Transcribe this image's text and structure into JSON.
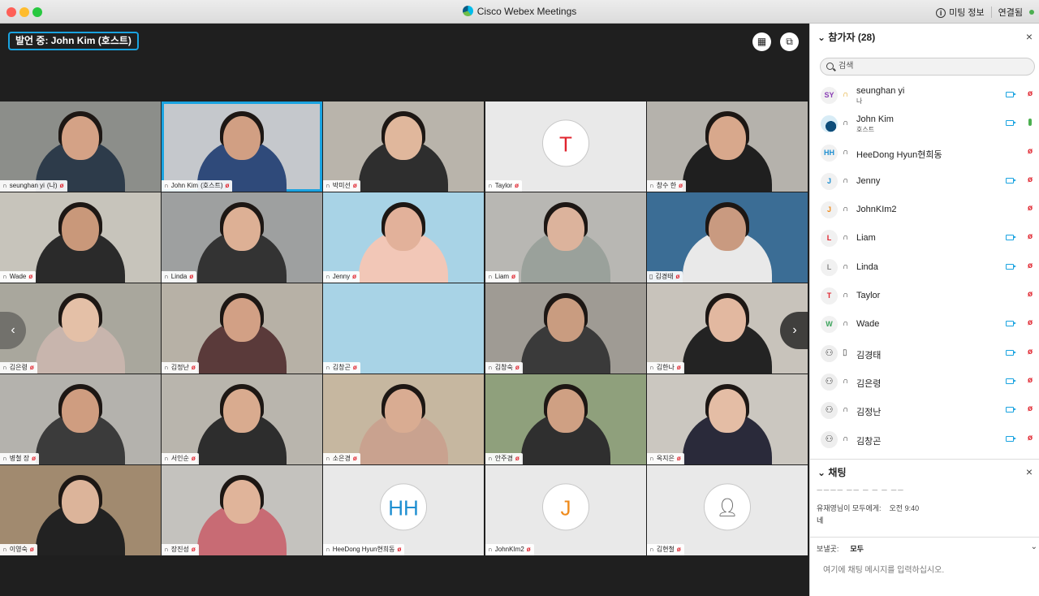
{
  "titlebar": {
    "title": "Cisco Webex Meetings",
    "meeting_info": "미팅 정보",
    "connection": "연결됨"
  },
  "stage": {
    "speaker": "발언 중:  John Kim (호스트)",
    "layout_icon": "grid-icon",
    "popout_icon": "popout-icon",
    "prev_arrow": "‹",
    "next_arrow": "›"
  },
  "tiles": [
    {
      "name": "seunghan yi",
      "suffix": "(나)",
      "bg": "#8c8e8a",
      "skin": "#d4a286",
      "shirt": "#2d3b4a",
      "icon": "headset"
    },
    {
      "name": "John Kim",
      "suffix": "(호스트)",
      "bg": "#c5c8cc",
      "skin": "#d19f83",
      "shirt": "#2f4a7a",
      "icon": "headset",
      "active": true
    },
    {
      "name": "박미선",
      "bg": "#b9b4ab",
      "skin": "#e0b79c",
      "shirt": "#2e2e2e",
      "icon": "headset"
    },
    {
      "name": "Taylor",
      "avatar": "T",
      "avatar_color": "#e0242e",
      "icon": "headset"
    },
    {
      "name": "창수 한",
      "bg": "#b5b2ac",
      "skin": "#d8a88c",
      "shirt": "#1f1f1f",
      "icon": "headset"
    },
    {
      "name": "Wade",
      "bg": "#c7c4bb",
      "skin": "#c9987a",
      "shirt": "#2a2a2a",
      "icon": "headset"
    },
    {
      "name": "Linda",
      "bg": "#9ea0a0",
      "skin": "#ddb095",
      "shirt": "#333333",
      "icon": "headset"
    },
    {
      "name": "Jenny",
      "bg": "#a8d3e6",
      "skin": "#e2b19a",
      "shirt": "#f2c7b7",
      "icon": "headset"
    },
    {
      "name": "Liam",
      "bg": "#b8b7b3",
      "skin": "#dcb39c",
      "shirt": "#9aa19b",
      "icon": "headset"
    },
    {
      "name": "김경태",
      "bg": "#3b6d95",
      "skin": "#c99a80",
      "shirt": "#e9e9e9",
      "icon": "phone"
    },
    {
      "name": "김은령",
      "bg": "#a9a79d",
      "skin": "#e4c0a7",
      "shirt": "#c8b5ad",
      "icon": "headset"
    },
    {
      "name": "김정난",
      "bg": "#b7b1a6",
      "skin": "#d2a085",
      "shirt": "#5a3a3a",
      "icon": "headset"
    },
    {
      "name": "김창곤",
      "bg": "#a8d3e6",
      "skin": "#a8d3e6",
      "shirt": "#a8d3e6",
      "icon": "headset"
    },
    {
      "name": "김창숙",
      "bg": "#9f9b94",
      "skin": "#c99c80",
      "shirt": "#3a3a3a",
      "icon": "headset"
    },
    {
      "name": "김한나",
      "bg": "#c8c3bb",
      "skin": "#e2b8a0",
      "shirt": "#232323",
      "icon": "headset"
    },
    {
      "name": "병철 장",
      "bg": "#b4b2ad",
      "skin": "#cf9d80",
      "shirt": "#3b3b3b",
      "icon": "headset"
    },
    {
      "name": "서인순",
      "bg": "#b9b5ad",
      "skin": "#d9ab8f",
      "shirt": "#2d2d2d",
      "icon": "headset"
    },
    {
      "name": "소은경",
      "bg": "#c6b7a0",
      "skin": "#d9ac92",
      "shirt": "#c9a28f",
      "icon": "headset"
    },
    {
      "name": "안주경",
      "bg": "#8fa07c",
      "skin": "#cfa083",
      "shirt": "#2f2f2f",
      "icon": "headset"
    },
    {
      "name": "옥지은",
      "bg": "#cbc7c0",
      "skin": "#e4bda5",
      "shirt": "#2a2a3a",
      "icon": "headset"
    },
    {
      "name": "이영숙",
      "bg": "#a18a6f",
      "skin": "#dcb49a",
      "shirt": "#222222",
      "icon": "headset"
    },
    {
      "name": "장진성",
      "bg": "#c4c2be",
      "skin": "#e0b49a",
      "shirt": "#c86b74",
      "icon": "headset"
    },
    {
      "name": "HeeDong Hyun현희동",
      "avatar": "HH",
      "avatar_color": "#1f8fd1",
      "icon": "headset"
    },
    {
      "name": "JohnKIm2",
      "avatar": "J",
      "avatar_color": "#ef8b1c",
      "icon": "headset"
    },
    {
      "name": "김현철",
      "avatar": "user",
      "avatar_color": "#444444",
      "icon": "headset"
    }
  ],
  "participants": {
    "title": "참가자 (28)",
    "search_placeholder": "검색",
    "list": [
      {
        "initials": "SY",
        "color": "#8a3fb5",
        "name": "seunghan yi",
        "sub": "나",
        "icon": "headset-warn",
        "cam": true,
        "muted": true
      },
      {
        "initials": "",
        "color": "#1aa3e0",
        "name": "John Kim",
        "sub": "호스트",
        "icon": "headset",
        "cam": true,
        "muted": false,
        "logo": true
      },
      {
        "initials": "HH",
        "color": "#1f8fd1",
        "name": "HeeDong Hyun현희동",
        "icon": "headset",
        "cam": false,
        "muted": true
      },
      {
        "initials": "J",
        "color": "#1f8fd1",
        "name": "Jenny",
        "icon": "headset",
        "cam": true,
        "muted": true
      },
      {
        "initials": "J",
        "color": "#ef8b1c",
        "name": "JohnKIm2",
        "icon": "headset",
        "cam": false,
        "muted": true
      },
      {
        "initials": "L",
        "color": "#e0242e",
        "name": "Liam",
        "icon": "headset",
        "cam": true,
        "muted": true
      },
      {
        "initials": "L",
        "color": "#888888",
        "name": "Linda",
        "icon": "headset",
        "cam": true,
        "muted": true
      },
      {
        "initials": "T",
        "color": "#e0242e",
        "name": "Taylor",
        "icon": "headset",
        "cam": false,
        "muted": true
      },
      {
        "initials": "W",
        "color": "#3aa35a",
        "name": "Wade",
        "icon": "headset",
        "cam": true,
        "muted": true
      },
      {
        "initials": "user",
        "color": "#444444",
        "name": "김경태",
        "icon": "phone",
        "cam": true,
        "muted": true
      },
      {
        "initials": "user",
        "color": "#444444",
        "name": "김은령",
        "icon": "headset",
        "cam": true,
        "muted": true
      },
      {
        "initials": "user",
        "color": "#444444",
        "name": "김정난",
        "icon": "headset",
        "cam": true,
        "muted": true
      },
      {
        "initials": "user",
        "color": "#444444",
        "name": "김창곤",
        "icon": "headset",
        "cam": true,
        "muted": true
      }
    ]
  },
  "chat": {
    "title": "채팅",
    "cut_text": "ㅡㅡㅡㅡ ㅡㅡ ㅡ ㅡ ㅡ ㅡㅡ",
    "sender": "유재영님이 모두에게:",
    "time": "오전 9:40",
    "message": "네",
    "send_to_label": "보낼곳:",
    "send_to_value": "모두",
    "input_placeholder": "여기에 채팅 메시지를 입력하십시오."
  }
}
